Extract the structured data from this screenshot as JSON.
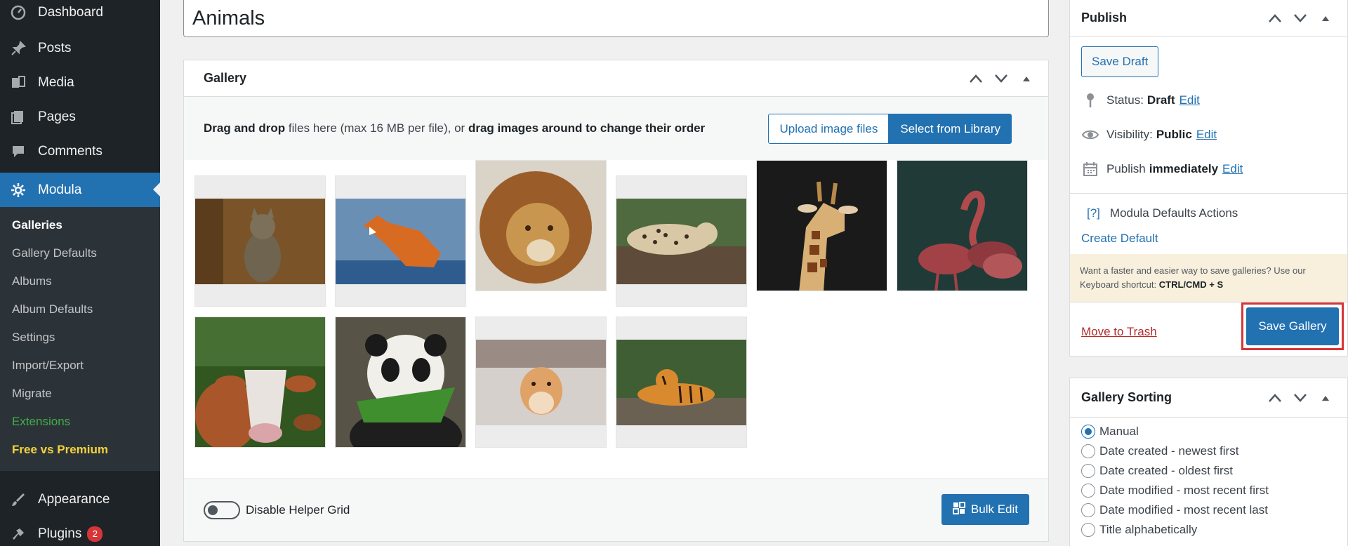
{
  "sidebar": {
    "items_top": [
      {
        "label": "Dashboard",
        "icon": "dashboard-icon"
      },
      {
        "label": "Posts",
        "icon": "pin-icon"
      },
      {
        "label": "Media",
        "icon": "media-icon"
      },
      {
        "label": "Pages",
        "icon": "pages-icon"
      },
      {
        "label": "Comments",
        "icon": "comments-icon"
      },
      {
        "label": "Modula",
        "icon": "gear-icon"
      }
    ],
    "submenu": [
      "Galleries",
      "Gallery Defaults",
      "Albums",
      "Album Defaults",
      "Settings",
      "Import/Export",
      "Migrate",
      "Extensions",
      "Free vs Premium"
    ],
    "items_bottom": [
      {
        "label": "Appearance",
        "icon": "brush-icon"
      },
      {
        "label": "Plugins",
        "icon": "plugin-icon",
        "badge": "2"
      }
    ]
  },
  "title": {
    "value": "Animals"
  },
  "gallery": {
    "title": "Gallery",
    "upload_text_1": "Drag and drop",
    "upload_text_2": " files here (max 16 MB per file), or ",
    "upload_text_3": "drag images around to change their order",
    "upload_button": "Upload image files",
    "library_button": "Select from Library",
    "images": [
      "Cat",
      "Fox",
      "Lion",
      "Leopard",
      "Giraffe",
      "Flamingos",
      "Cow",
      "Panda",
      "Hamster",
      "Tiger"
    ],
    "helper_grid_label": "Disable Helper Grid",
    "bulk_edit_label": "Bulk Edit"
  },
  "publish": {
    "title": "Publish",
    "save_draft": "Save Draft",
    "status_label": "Status:",
    "status_value": "Draft",
    "visibility_label": "Visibility:",
    "visibility_value": "Public",
    "publish_label": "Publish",
    "publish_value": "immediately",
    "edit_link": "Edit",
    "defaults_q": "[?]",
    "defaults_label": "Modula Defaults Actions",
    "create_default": "Create Default",
    "notice_text": "Want a faster and easier way to save galleries? Use our Keyboard shortcut:",
    "notice_shortcut": "CTRL/CMD + S",
    "move_to_trash": "Move to Trash",
    "save_gallery": "Save Gallery"
  },
  "sorting": {
    "title": "Gallery Sorting",
    "options": [
      "Manual",
      "Date created - newest first",
      "Date created - oldest first",
      "Date modified - most recent first",
      "Date modified - most recent last",
      "Title alphabetically"
    ],
    "selected": "Manual"
  },
  "colors": {
    "accent": "#2271b1",
    "sidebar": "#1d2327",
    "highlight": "#d63638"
  }
}
